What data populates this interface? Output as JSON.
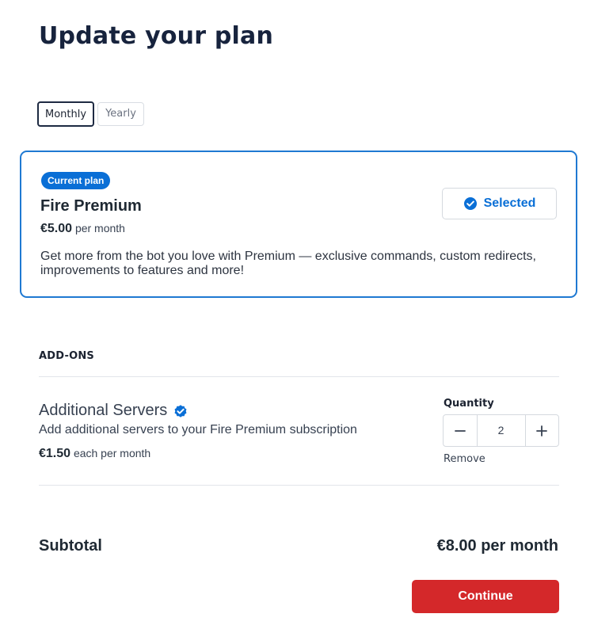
{
  "page": {
    "title": "Update your plan"
  },
  "billing_toggle": {
    "options": [
      {
        "label": "Monthly",
        "active": true
      },
      {
        "label": "Yearly",
        "active": false
      }
    ]
  },
  "plan": {
    "badge": "Current plan",
    "name": "Fire Premium",
    "price": "€5.00",
    "price_suffix": "per month",
    "description": "Get more from the bot you love with Premium — exclusive commands, custom redirects, improvements to features and more!",
    "selected_label": "Selected"
  },
  "addons": {
    "heading": "ADD-ONS",
    "items": [
      {
        "name": "Additional Servers",
        "description": "Add additional servers to your Fire Premium subscription",
        "price": "€1.50",
        "price_suffix": "each per month",
        "quantity_label": "Quantity",
        "quantity": "2",
        "remove_label": "Remove"
      }
    ]
  },
  "summary": {
    "subtotal_label": "Subtotal",
    "subtotal_value": "€8.00 per month",
    "continue_label": "Continue"
  },
  "colors": {
    "accent_blue": "#0a6fd6",
    "card_border": "#1f79d2",
    "continue_red": "#d4282a"
  },
  "icons": {
    "selected": "check-circle-icon",
    "verified": "verified-check-icon",
    "decrement": "minus-icon",
    "increment": "plus-icon"
  }
}
